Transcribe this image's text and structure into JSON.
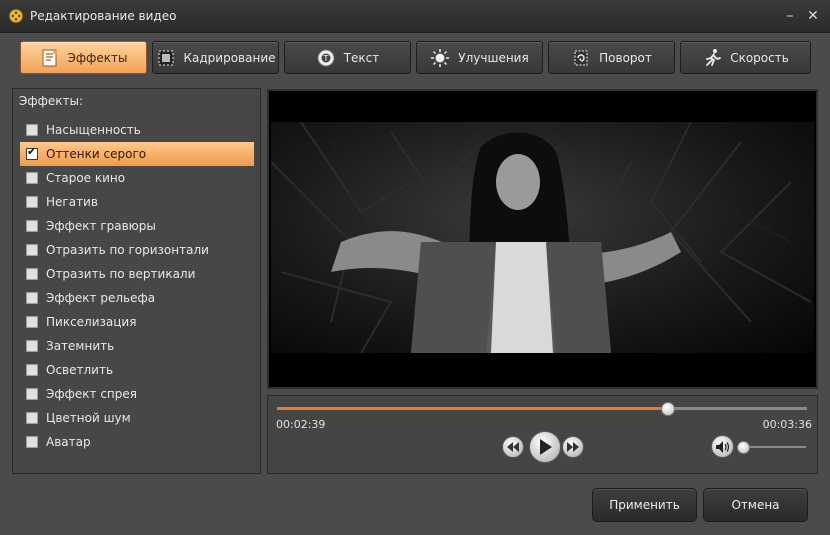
{
  "window": {
    "title": "Редактирование видео",
    "minimize_glyph": "–",
    "close_glyph": "✕"
  },
  "tabs": [
    {
      "label": "Эффекты",
      "icon": "effects-icon",
      "active": true
    },
    {
      "label": "Кадрирование",
      "icon": "crop-icon",
      "active": false
    },
    {
      "label": "Текст",
      "icon": "text-icon",
      "active": false
    },
    {
      "label": "Улучшения",
      "icon": "brightness-icon",
      "active": false
    },
    {
      "label": "Поворот",
      "icon": "rotate-icon",
      "active": false
    },
    {
      "label": "Скорость",
      "icon": "running-icon",
      "active": false
    }
  ],
  "effects_panel": {
    "title": "Эффекты:",
    "items": [
      {
        "label": "Насыщенность",
        "checked": false
      },
      {
        "label": "Оттенки серого",
        "checked": true
      },
      {
        "label": "Старое кино",
        "checked": false
      },
      {
        "label": "Негатив",
        "checked": false
      },
      {
        "label": "Эффект гравюры",
        "checked": false
      },
      {
        "label": "Отразить по горизонтали",
        "checked": false
      },
      {
        "label": "Отразить по вертикали",
        "checked": false
      },
      {
        "label": "Эффект рельефа",
        "checked": false
      },
      {
        "label": "Пикселизация",
        "checked": false
      },
      {
        "label": "Затемнить",
        "checked": false
      },
      {
        "label": "Осветлить",
        "checked": false
      },
      {
        "label": "Эффект спрея",
        "checked": false
      },
      {
        "label": "Цветной шум",
        "checked": false
      },
      {
        "label": "Аватар",
        "checked": false
      }
    ],
    "checkmark": "✔"
  },
  "player": {
    "current_time": "00:02:39",
    "total_time": "00:03:36",
    "progress": 0.736,
    "volume": 0.0
  },
  "buttons": {
    "apply": "Применить",
    "cancel": "Отмена"
  },
  "colors": {
    "accent": "#f39a4e",
    "progress": "#f07a2a"
  }
}
